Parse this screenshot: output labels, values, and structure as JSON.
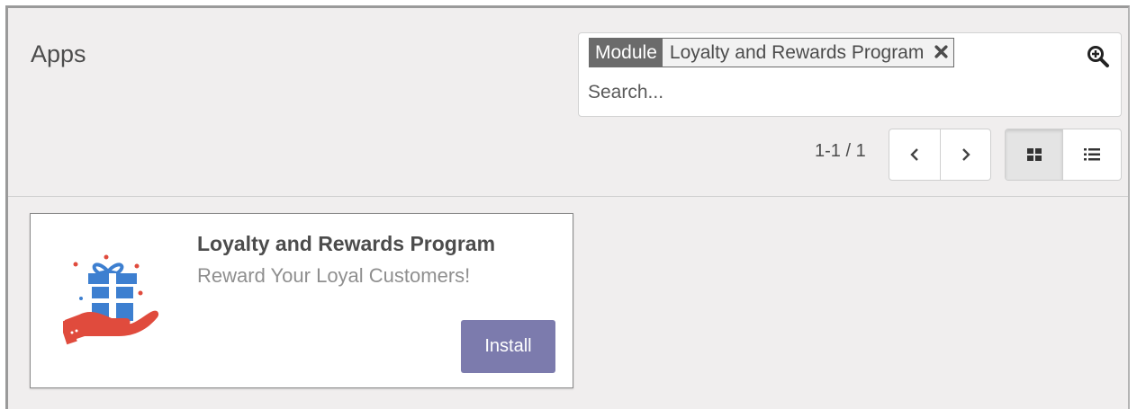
{
  "header": {
    "title": "Apps"
  },
  "search": {
    "facet_label": "Module",
    "facet_value": "Loyalty and Rewards Program",
    "placeholder": "Search..."
  },
  "pager": {
    "value": "1-1 / 1"
  },
  "view_switcher": {
    "active": "kanban"
  },
  "card": {
    "name": "Loyalty and Rewards Program",
    "summary": "Reward Your Loyal Customers!",
    "install_label": "Install"
  },
  "colors": {
    "install": "#7c7bad",
    "gift_blue": "#3d7fd0",
    "hand_red": "#e04b3d"
  }
}
